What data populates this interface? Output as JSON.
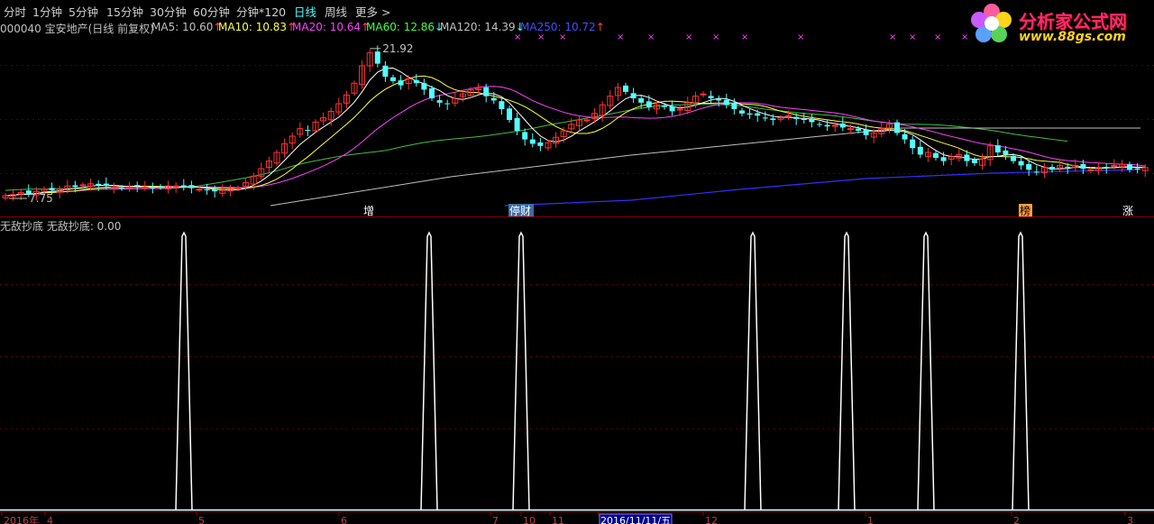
{
  "toolbar": {
    "items": [
      "分时",
      "1分钟",
      "5分钟",
      "15分钟",
      "30分钟",
      "60分钟",
      "分钟*120",
      "日线",
      "周线",
      "更多 >"
    ],
    "active_index": 7
  },
  "info": {
    "security": "000040 宝安地产(日线 前复权)",
    "ma5": {
      "label": "MA5: 10.60",
      "arrow": "↑",
      "color": "#ffffff"
    },
    "ma10": {
      "label": "MA10: 10.83",
      "arrow": "↑",
      "color": "#ffff40"
    },
    "ma20": {
      "label": "MA20: 10.64",
      "arrow": "↑",
      "color": "#ff40ff"
    },
    "ma60": {
      "label": "MA60: 12.86",
      "arrow": "↓",
      "color": "#40ff40"
    },
    "ma120": {
      "label": "MA120: 14.39",
      "arrow": "↓",
      "color": "#c0c0c0"
    },
    "ma250": {
      "label": "MA250: 10.72",
      "arrow": "↑",
      "color": "#4040ff"
    }
  },
  "logo": {
    "name": "分析家公式网",
    "url": "www.88gs.com"
  },
  "price_labels": {
    "high": "21.92",
    "low": "7.75"
  },
  "event_markers": [
    {
      "text": "增",
      "bg": "#000000",
      "color": "#ffffff"
    },
    {
      "text": "停财",
      "bg": "#3a6ea5",
      "color": "#ffffff"
    },
    {
      "text": "榜",
      "bg": "#ffa040",
      "color": "#000000"
    },
    {
      "text": "涨",
      "bg": "#000000",
      "color": "#ffffff"
    }
  ],
  "indicator": {
    "label": "无敌抄底  无敌抄底: 0.00"
  },
  "date_axis": {
    "labels": [
      "2016年",
      "4",
      "5",
      "6",
      "7",
      "10",
      "11",
      "2016/11/11/五",
      "12",
      "1",
      "2",
      "3"
    ],
    "highlighted": "2016/11/11/五"
  },
  "colors": {
    "up": "#ff3232",
    "down": "#54ffff",
    "grid": "#8b0000",
    "background": "#000000"
  },
  "chart_data": {
    "type": "candlestick",
    "y_range": [
      7.75,
      21.92
    ],
    "closes": [
      8.0,
      8.1,
      8.3,
      8.2,
      8.4,
      8.6,
      8.5,
      8.6,
      8.9,
      8.8,
      9.0,
      9.1,
      9.0,
      8.9,
      8.8,
      8.7,
      8.8,
      8.9,
      8.8,
      8.7,
      8.8,
      8.9,
      8.9,
      8.8,
      8.7,
      8.6,
      8.5,
      8.4,
      8.5,
      8.6,
      8.7,
      9.2,
      9.8,
      10.5,
      11.2,
      12.0,
      12.8,
      13.5,
      14.2,
      14.0,
      14.8,
      15.2,
      15.8,
      16.5,
      17.3,
      18.4,
      20.0,
      21.2,
      20.2,
      19.0,
      18.6,
      18.2,
      18.8,
      18.4,
      17.8,
      17.0,
      16.6,
      16.5,
      17.0,
      17.4,
      17.8,
      17.9,
      17.2,
      16.8,
      16.0,
      15.0,
      14.0,
      13.2,
      12.8,
      12.6,
      12.9,
      13.4,
      14.0,
      14.6,
      15.0,
      15.0,
      15.6,
      16.4,
      17.2,
      18.0,
      17.6,
      17.0,
      16.6,
      16.2,
      16.4,
      16.2,
      15.8,
      16.0,
      16.6,
      17.2,
      17.4,
      17.0,
      16.8,
      16.4,
      16.0,
      15.6,
      15.5,
      15.4,
      15.2,
      15.0,
      15.2,
      15.4,
      15.1,
      15.0,
      14.8,
      14.6,
      14.4,
      14.5,
      14.3,
      14.2,
      14.0,
      13.6,
      13.8,
      14.2,
      14.6,
      13.8,
      13.2,
      12.4,
      11.8,
      12.0,
      11.5,
      11.2,
      11.6,
      11.8,
      11.2,
      11.0,
      11.4,
      12.6,
      12.0,
      11.8,
      11.2,
      10.8,
      10.4,
      10.2,
      10.6,
      10.4,
      10.8,
      10.6,
      10.8,
      10.5,
      10.4,
      10.6,
      10.6,
      10.8,
      10.9,
      10.4,
      10.5,
      10.6
    ],
    "ma60_last": 12.86,
    "ma120_last": 14.39,
    "ma250_last": 10.72,
    "event_candle_index": [
      52,
      69,
      131,
      147
    ],
    "indicator_series": {
      "name": "无敌抄底",
      "value": 0.0,
      "spike_candles": [
        23,
        56,
        67,
        96,
        108,
        118,
        130
      ],
      "spike_height": 1.0
    }
  }
}
